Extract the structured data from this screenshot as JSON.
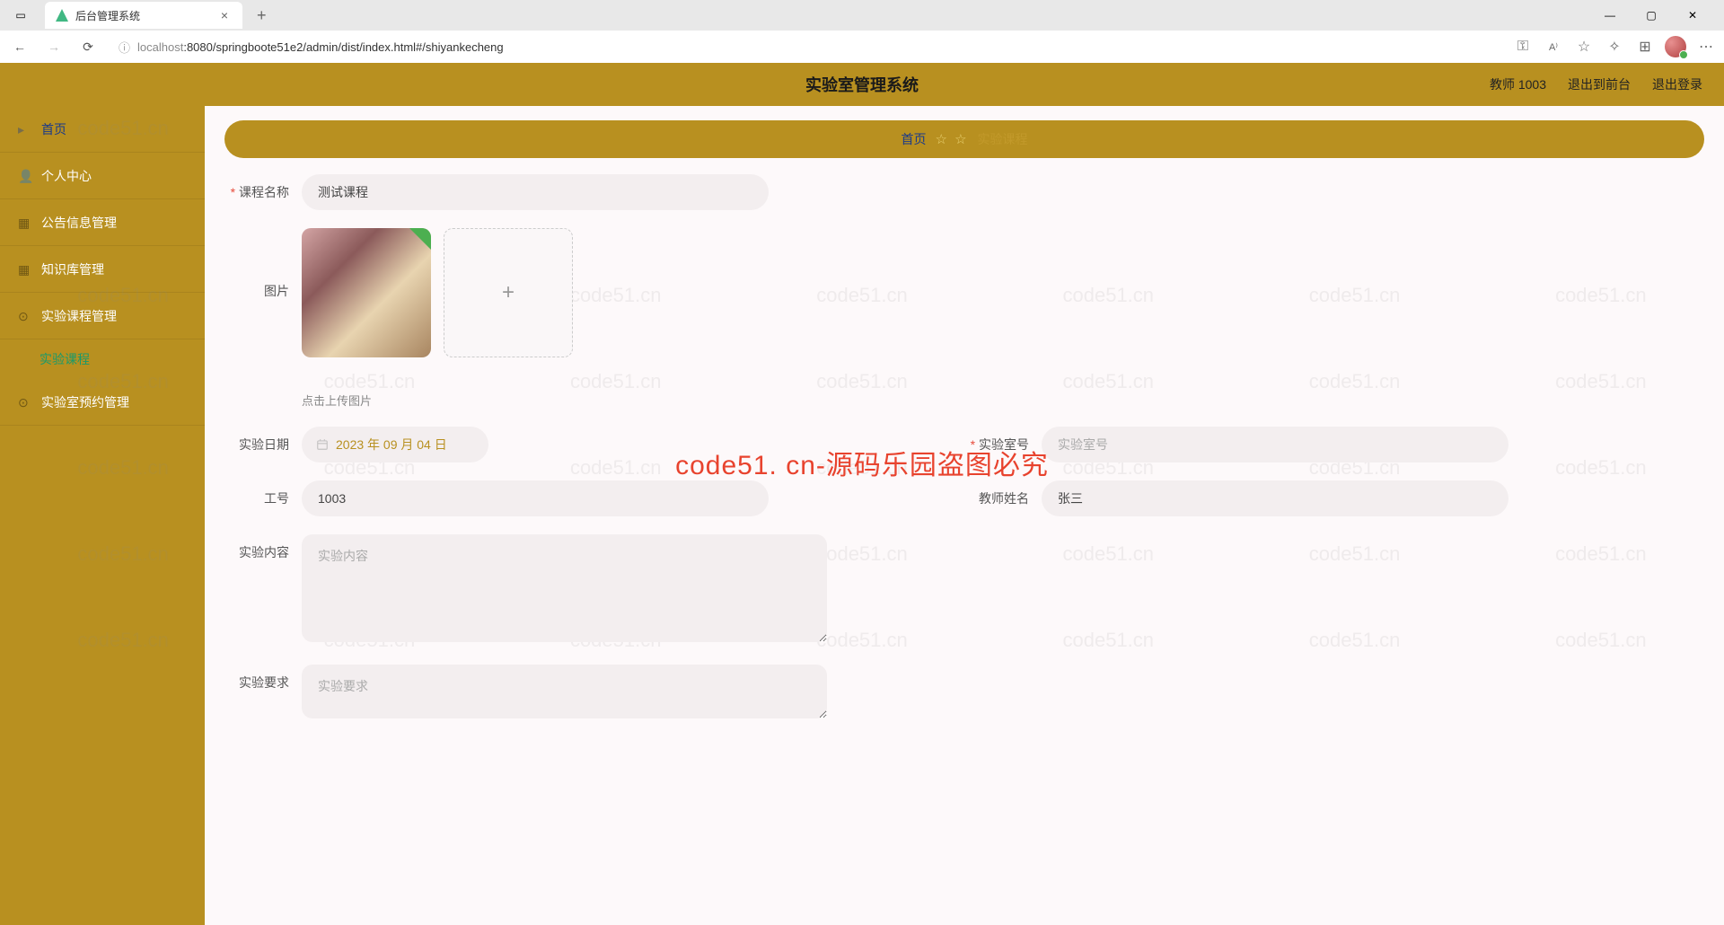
{
  "browser": {
    "tab_title": "后台管理系统",
    "url_host": "localhost",
    "url_port_path": ":8080/springboote51e2/admin/dist/index.html#/shiyankecheng"
  },
  "header": {
    "title": "实验室管理系统",
    "user": "教师 1003",
    "exit_front": "退出到前台",
    "logout": "退出登录"
  },
  "sidebar": {
    "home": "首页",
    "profile": "个人中心",
    "notice": "公告信息管理",
    "knowledge": "知识库管理",
    "course_mgmt": "实验课程管理",
    "course_sub": "实验课程",
    "reservation": "实验室预约管理"
  },
  "breadcrumb": {
    "home": "首页",
    "current": "实验课程"
  },
  "form": {
    "course_name_label": "课程名称",
    "course_name_value": "测试课程",
    "image_label": "图片",
    "upload_hint": "点击上传图片",
    "date_label": "实验日期",
    "date_value": "2023 年 09 月 04 日",
    "lab_no_label": "实验室号",
    "lab_no_placeholder": "实验室号",
    "staff_no_label": "工号",
    "staff_no_value": "1003",
    "teacher_label": "教师姓名",
    "teacher_value": "张三",
    "content_label": "实验内容",
    "content_placeholder": "实验内容",
    "require_label": "实验要求",
    "require_placeholder": "实验要求"
  },
  "watermark": {
    "small": "code51.cn",
    "center": "code51. cn-源码乐园盗图必究"
  }
}
